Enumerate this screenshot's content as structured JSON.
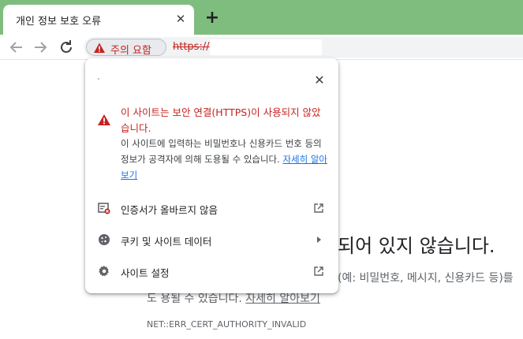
{
  "tab": {
    "title": "개인 정보 보호 오류",
    "close_icon": "close-icon"
  },
  "new_tab_icon": "plus-icon",
  "toolbar": {
    "back_icon": "arrow-left-icon",
    "forward_icon": "arrow-right-icon",
    "reload_icon": "reload-icon",
    "security_chip_label": "주의 요함",
    "url": "https://",
    "warning_color": "#c5221f"
  },
  "popup": {
    "close_icon": "close-icon",
    "warning_title": "이 사이트는 보안 연결(HTTPS)이 사용되지 않았습니다.",
    "warning_description": "이 사이트에 입력하는 비밀번호나 신용카드 번호 등의 정보가 공격자에 의해 도용될 수 있습니다.",
    "learn_more_link": "자세히 알아보기",
    "items": [
      {
        "label": "인증서가 올바르지 않음",
        "icon": "certificate-icon",
        "trailing_icon": "external-link-icon"
      },
      {
        "label": "쿠키 및 사이트 데이터",
        "icon": "cookie-icon",
        "trailing_icon": "chevron-right-icon"
      },
      {
        "label": "사이트 설정",
        "icon": "gear-icon",
        "trailing_icon": "external-link-icon"
      }
    ]
  },
  "background_page": {
    "heading_fragment": "되어 있지 않습니다.",
    "paragraph_fragment": "(예: 비밀번호, 메시지, 신용카드 등)를",
    "paragraph_line2_prefix": "도 용될 수 있습니다.",
    "learn_more_link": "자세히 알아보기",
    "error_code": "NET::ERR_CERT_AUTHORITY_INVALID"
  }
}
